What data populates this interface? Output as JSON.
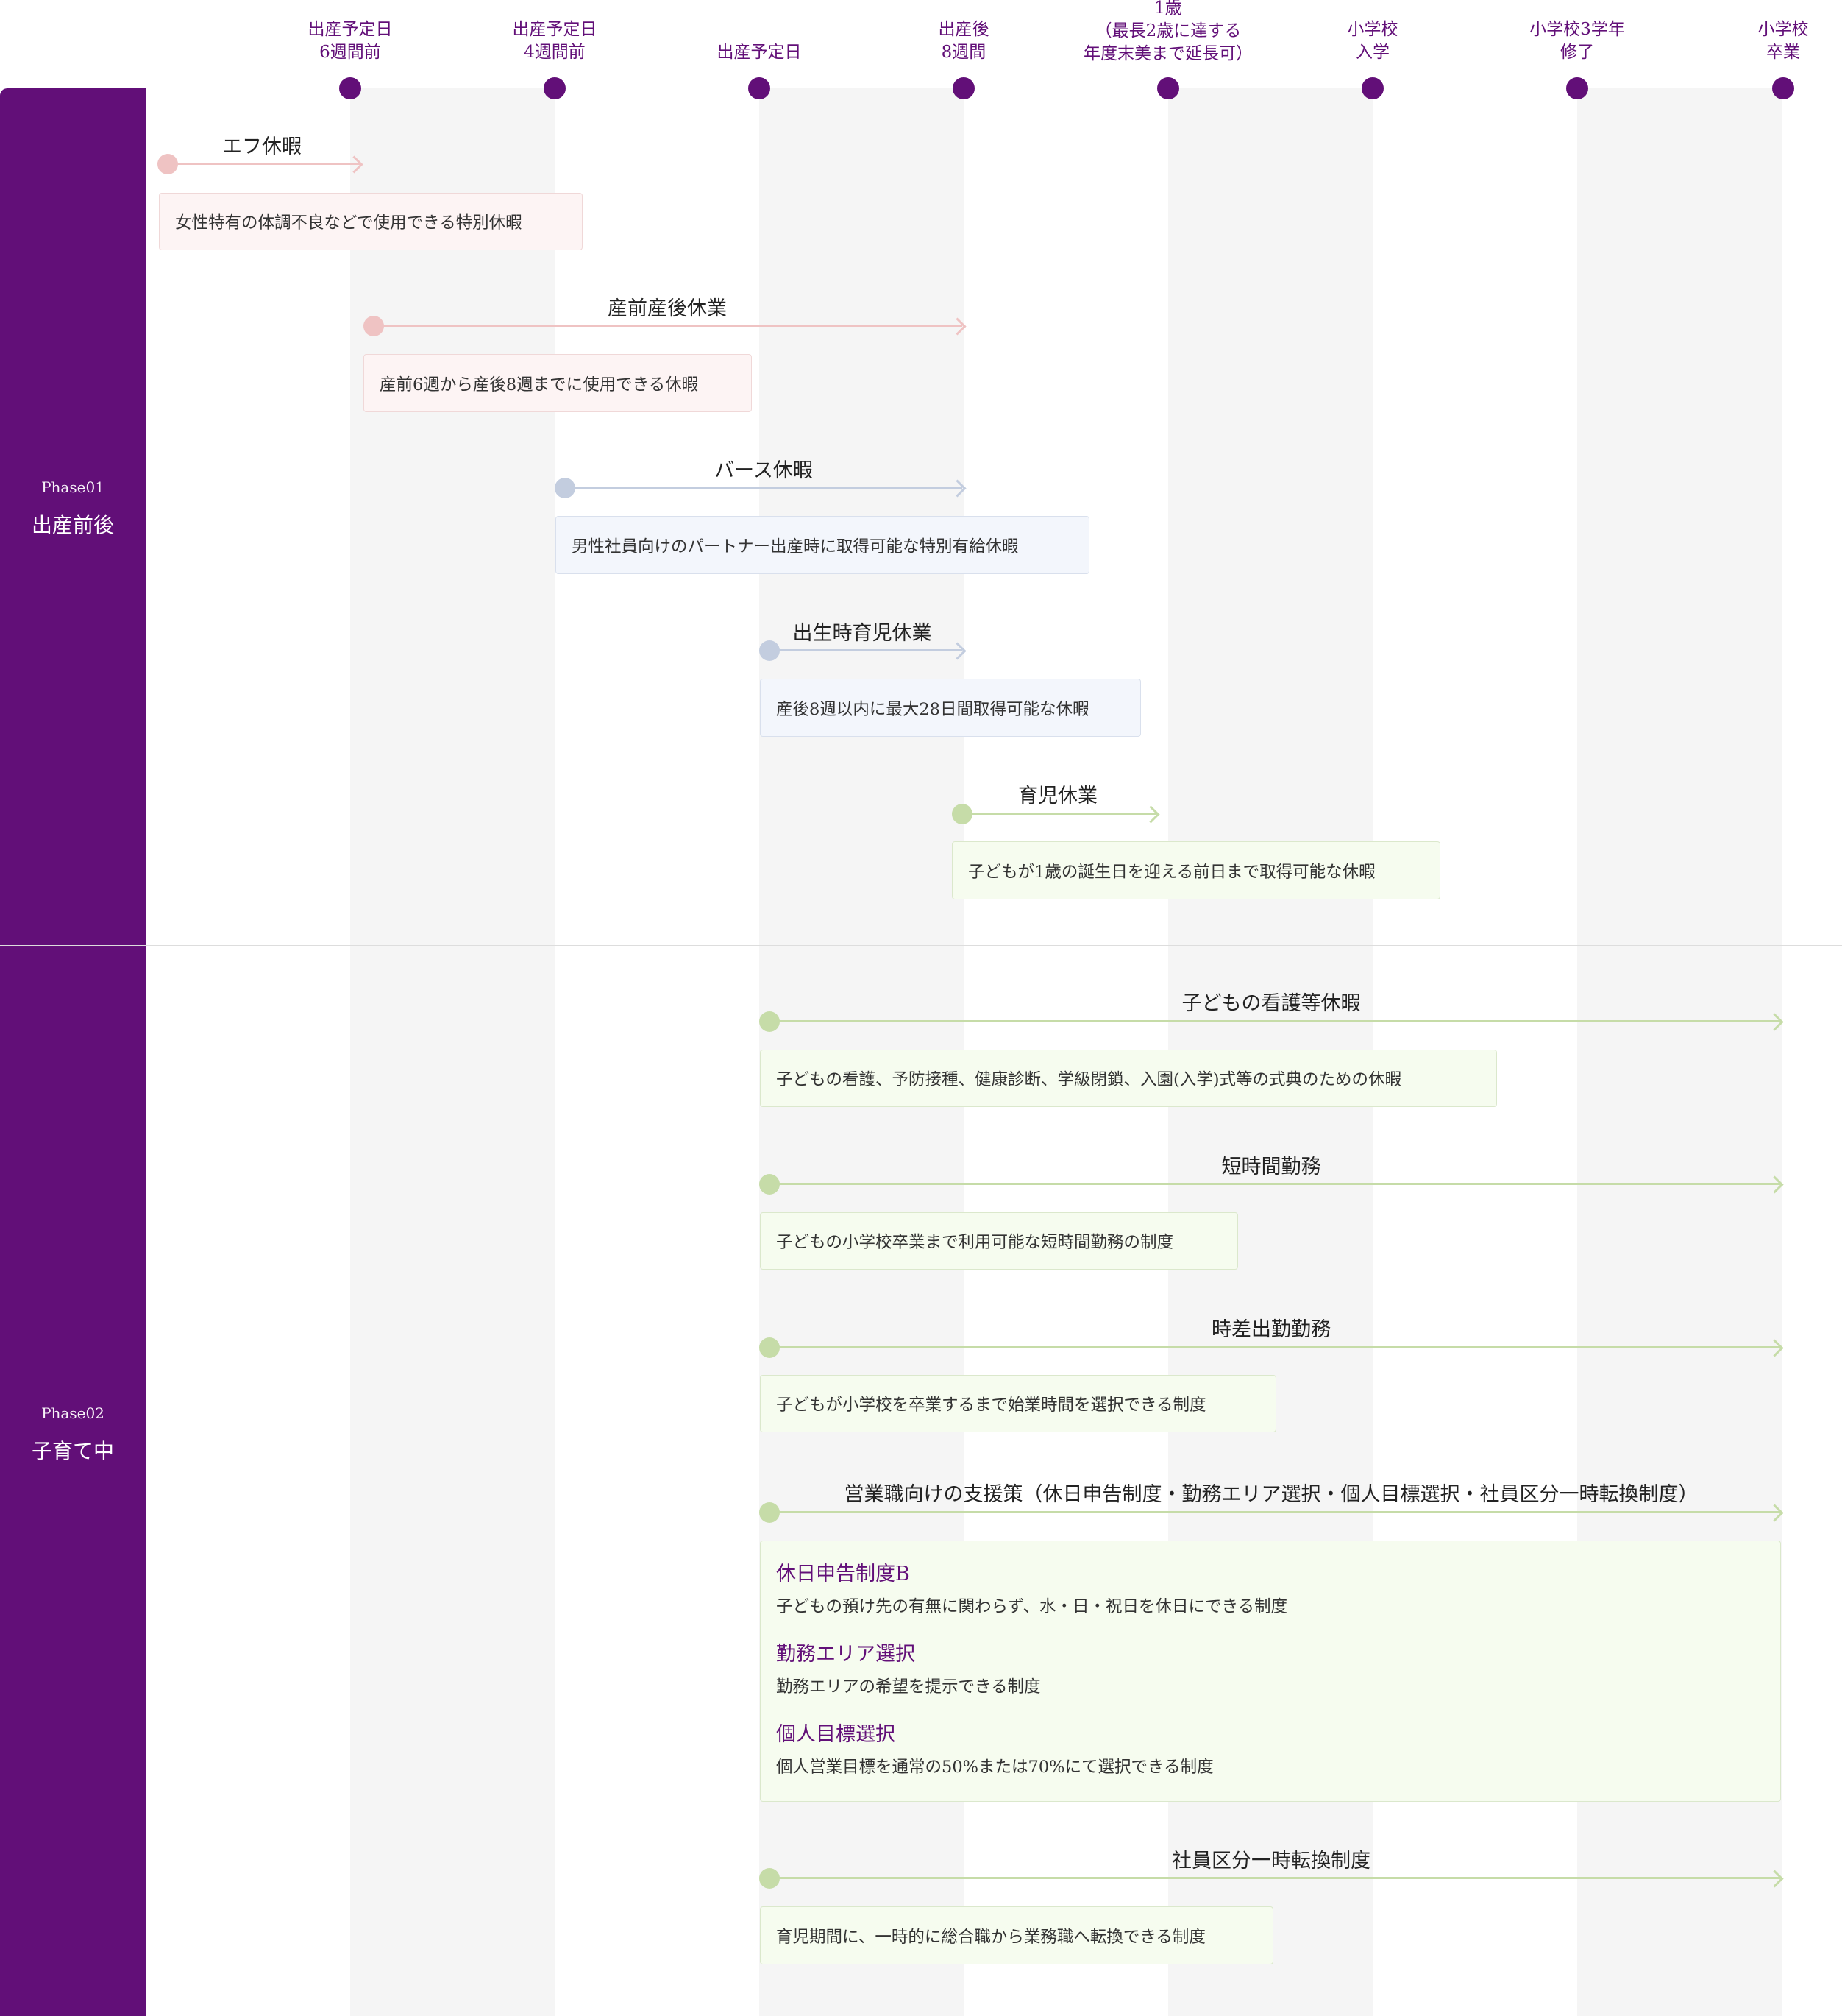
{
  "colors": {
    "brand": "#620f78",
    "pink": "#efc3c3",
    "blue": "#c3cddf",
    "green": "#c6dca8"
  },
  "milestones": [
    {
      "label": "出産予定日\n6週間前"
    },
    {
      "label": "出産予定日\n4週間前"
    },
    {
      "label": "出産予定日"
    },
    {
      "label": "出産後\n8週間"
    },
    {
      "label": "1歳\n（最長2歳に達する\n年度末美まで延長可）"
    },
    {
      "label": "小学校\n入学"
    },
    {
      "label": "小学校3学年\n修了"
    },
    {
      "label": "小学校\n卒業"
    }
  ],
  "phases": [
    {
      "label": "Phase01",
      "title": "出産前後"
    },
    {
      "label": "Phase02",
      "title": "子育て中"
    }
  ],
  "programs": [
    {
      "title": "エフ休暇",
      "color": "pink",
      "description": "女性特有の体調不良などで使用できる特別休暇"
    },
    {
      "title": "産前産後休業",
      "color": "pink",
      "description": "産前6週から産後8週までに使用できる休暇"
    },
    {
      "title": "バース休暇",
      "color": "blue",
      "description": "男性社員向けのパートナー出産時に取得可能な特別有給休暇"
    },
    {
      "title": "出生時育児休業",
      "color": "blue",
      "description": "産後8週以内に最大28日間取得可能な休暇"
    },
    {
      "title": "育児休業",
      "color": "green",
      "description": "子どもが1歳の誕生日を迎える前日まで取得可能な休暇"
    },
    {
      "title": "子どもの看護等休暇",
      "color": "green",
      "description": "子どもの看護、予防接種、健康診断、学級閉鎖、入園(入学)式等の式典のための休暇"
    },
    {
      "title": "短時間勤務",
      "color": "green",
      "description": "子どもの小学校卒業まで利用可能な短時間勤務の制度"
    },
    {
      "title": "時差出勤勤務",
      "color": "green",
      "description": "子どもが小学校を卒業するまで始業時間を選択できる制度"
    },
    {
      "title": "営業職向けの支援策（休日申告制度・勤務エリア選択・個人目標選択・社員区分一時転換制度）",
      "color": "green",
      "items": [
        {
          "title": "休日申告制度B",
          "text": "子どもの預け先の有無に関わらず、水・日・祝日を休日にできる制度"
        },
        {
          "title": "勤務エリア選択",
          "text": "勤務エリアの希望を提示できる制度"
        },
        {
          "title": "個人目標選択",
          "text": "個人営業目標を通常の50%または70%にて選択できる制度"
        }
      ]
    },
    {
      "title": "社員区分一時転換制度",
      "color": "green",
      "description": "育児期間に、一時的に総合職から業務職へ転換できる制度"
    }
  ]
}
